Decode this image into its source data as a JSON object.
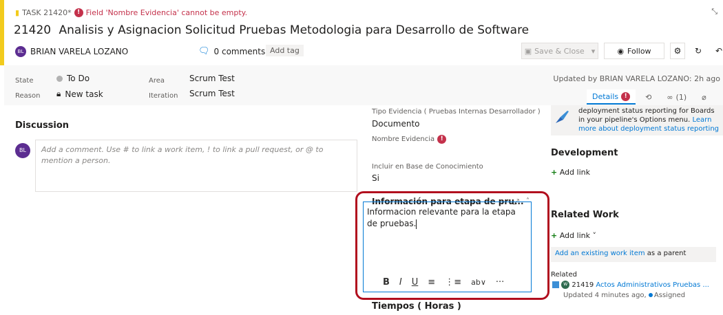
{
  "header": {
    "task_badge": "TASK 21420*",
    "error_message": "Field 'Nombre Evidencia' cannot be empty.",
    "work_item_id": "21420",
    "title": "Analisis y Asignacion Solicitud Pruebas Metodologia para Desarrollo de Software",
    "assignee_initials": "BL",
    "assignee": "BRIAN VARELA LOZANO",
    "comments": "0 comments",
    "add_tag": "Add tag",
    "save_close": "Save & Close",
    "follow": "Follow",
    "more": "···"
  },
  "fields": {
    "state_label": "State",
    "state_value": "To Do",
    "reason_label": "Reason",
    "reason_value": "New task",
    "area_label": "Area",
    "area_value": "Scrum Test",
    "iteration_label": "Iteration",
    "iteration_value": "Scrum Test",
    "updated": "Updated by BRIAN VARELA LOZANO: 2h ago"
  },
  "tabs": {
    "details": "Details",
    "links_count": "(1)"
  },
  "discussion": {
    "heading": "Discussion",
    "avatar": "BL",
    "placeholder": "Add a comment. Use # to link a work item, ! to link a pull request, or @ to mention a person."
  },
  "middle": {
    "tipo_label": "Tipo Evidencia ( Pruebas Internas Desarrollador )",
    "tipo_value": "Documento",
    "nombre_label": "Nombre Evidencia",
    "incluir_label": "Incluir en Base de Conocimiento",
    "incluir_value": "Si",
    "info_heading": "Información para etapa de pru...",
    "info_text": "Informacion relevante para la etapa de pruebas.",
    "tiempos_heading": "Tiempos ( Horas )"
  },
  "right": {
    "deploy_text": "deployment status reporting for Boards in your pipeline's Options menu.",
    "deploy_link": "Learn more about deployment status reporting",
    "development_heading": "Development",
    "add_link": "Add link",
    "related_work_heading": "Related Work",
    "add_existing": "Add an existing work item",
    "as_parent": "as a parent",
    "related_label": "Related",
    "related_id": "21419",
    "related_title": "Actos Administrativos Pruebas ...",
    "related_avatar": "W",
    "related_updated": "Updated 4 minutes ago,",
    "related_state": "Assigned"
  },
  "colors": {
    "accent": "#f2cb1d",
    "error": "#c4314b",
    "link": "#0078d4",
    "highlight": "#b10e1e"
  }
}
